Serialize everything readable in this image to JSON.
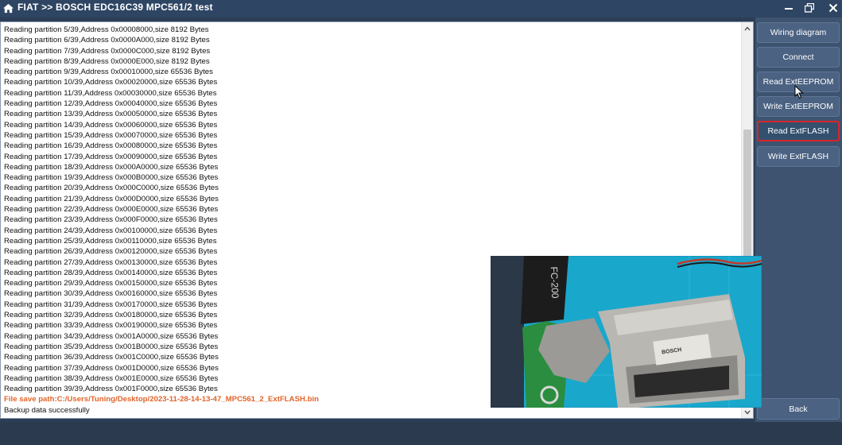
{
  "window": {
    "title": "FIAT >> BOSCH EDC16C39 MPC561/2 test",
    "controls": [
      "minimize-icon",
      "restore-icon",
      "close-icon"
    ]
  },
  "log": {
    "lines": [
      "Reading partition 5/39,Address 0x00008000,size 8192 Bytes",
      "Reading partition 6/39,Address 0x0000A000,size 8192 Bytes",
      "Reading partition 7/39,Address 0x0000C000,size 8192 Bytes",
      "Reading partition 8/39,Address 0x0000E000,size 8192 Bytes",
      "Reading partition 9/39,Address 0x00010000,size 65536 Bytes",
      "Reading partition 10/39,Address 0x00020000,size 65536 Bytes",
      "Reading partition 11/39,Address 0x00030000,size 65536 Bytes",
      "Reading partition 12/39,Address 0x00040000,size 65536 Bytes",
      "Reading partition 13/39,Address 0x00050000,size 65536 Bytes",
      "Reading partition 14/39,Address 0x00060000,size 65536 Bytes",
      "Reading partition 15/39,Address 0x00070000,size 65536 Bytes",
      "Reading partition 16/39,Address 0x00080000,size 65536 Bytes",
      "Reading partition 17/39,Address 0x00090000,size 65536 Bytes",
      "Reading partition 18/39,Address 0x000A0000,size 65536 Bytes",
      "Reading partition 19/39,Address 0x000B0000,size 65536 Bytes",
      "Reading partition 20/39,Address 0x000C0000,size 65536 Bytes",
      "Reading partition 21/39,Address 0x000D0000,size 65536 Bytes",
      "Reading partition 22/39,Address 0x000E0000,size 65536 Bytes",
      "Reading partition 23/39,Address 0x000F0000,size 65536 Bytes",
      "Reading partition 24/39,Address 0x00100000,size 65536 Bytes",
      "Reading partition 25/39,Address 0x00110000,size 65536 Bytes",
      "Reading partition 26/39,Address 0x00120000,size 65536 Bytes",
      "Reading partition 27/39,Address 0x00130000,size 65536 Bytes",
      "Reading partition 28/39,Address 0x00140000,size 65536 Bytes",
      "Reading partition 29/39,Address 0x00150000,size 65536 Bytes",
      "Reading partition 30/39,Address 0x00160000,size 65536 Bytes",
      "Reading partition 31/39,Address 0x00170000,size 65536 Bytes",
      "Reading partition 32/39,Address 0x00180000,size 65536 Bytes",
      "Reading partition 33/39,Address 0x00190000,size 65536 Bytes",
      "Reading partition 34/39,Address 0x001A0000,size 65536 Bytes",
      "Reading partition 35/39,Address 0x001B0000,size 65536 Bytes",
      "Reading partition 36/39,Address 0x001C0000,size 65536 Bytes",
      "Reading partition 37/39,Address 0x001D0000,size 65536 Bytes",
      "Reading partition 38/39,Address 0x001E0000,size 65536 Bytes",
      "Reading partition 39/39,Address 0x001F0000,size 65536 Bytes"
    ],
    "save_path": "File save path:C:/Users/Tuning/Desktop/2023-11-28-14-13-47_MPC561_2_ExtFLASH.bin",
    "status": "Backup data successfully"
  },
  "buttons": {
    "wiring_diagram": "Wiring diagram",
    "connect": "Connect",
    "read_ext_eeprom": "Read ExtEEPROM",
    "write_ext_eeprom": "Write ExtEEPROM",
    "read_ext_flash": "Read ExtFLASH",
    "write_ext_flash": "Write ExtFLASH",
    "back": "Back"
  },
  "photo": {
    "programmer_text": "FC-200",
    "ecu_brand": "BOSCH"
  },
  "colors": {
    "path_text": "#e0642a",
    "active_border": "#d7262a",
    "button": "#4b6282",
    "mat": "#1aa7cc"
  }
}
